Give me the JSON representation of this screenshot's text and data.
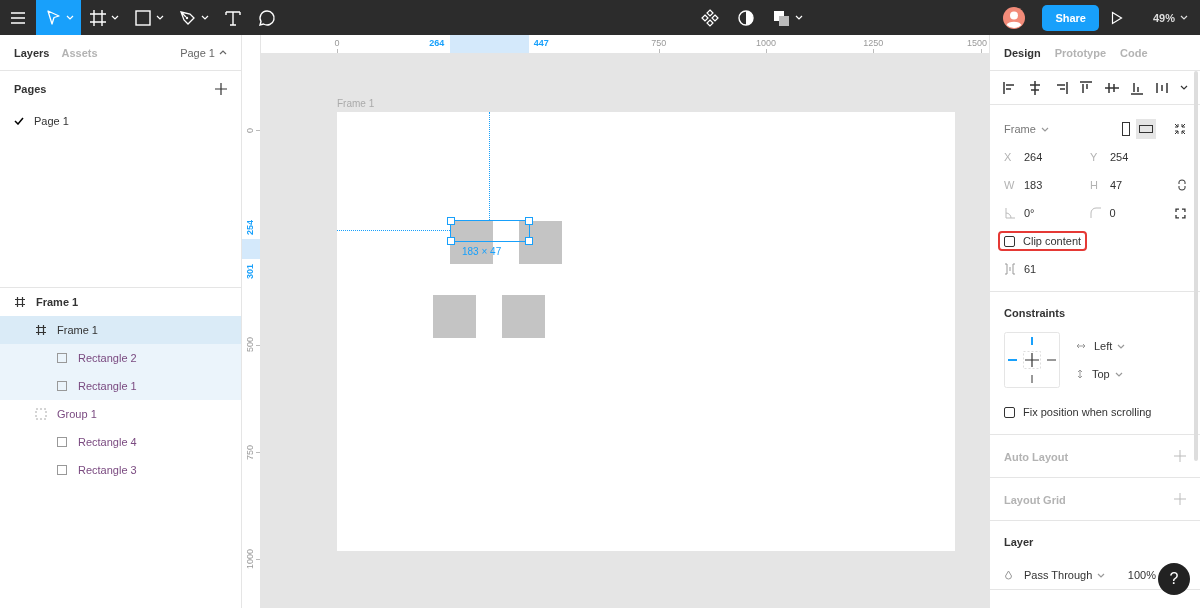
{
  "toolbar": {
    "tools": [
      {
        "kind": "menu",
        "selected": false,
        "menu": false
      },
      {
        "kind": "move",
        "selected": true,
        "menu": true
      },
      {
        "kind": "frame",
        "selected": false,
        "menu": true
      },
      {
        "kind": "rectangle",
        "selected": false,
        "menu": true
      },
      {
        "kind": "pen",
        "selected": false,
        "menu": true
      },
      {
        "kind": "text",
        "selected": false,
        "menu": false
      },
      {
        "kind": "comment",
        "selected": false,
        "menu": false
      }
    ],
    "center_tools": [
      {
        "kind": "component",
        "menu": false
      },
      {
        "kind": "mask",
        "menu": false
      },
      {
        "kind": "boolean",
        "menu": true
      }
    ],
    "share": "Share",
    "zoom": "49%"
  },
  "left_panel": {
    "tabs": [
      {
        "label": "Layers",
        "selected": true
      },
      {
        "label": "Assets",
        "selected": false
      }
    ],
    "page_menu": "Page 1",
    "pages_title": "Pages",
    "pages": [
      {
        "label": "Page 1",
        "selected": true
      }
    ],
    "layers": [
      {
        "name": "Frame 1",
        "kind": "frame",
        "selected": false,
        "children": [
          {
            "name": "Frame 1",
            "kind": "frame",
            "selected": true,
            "children": [
              {
                "name": "Rectangle 2",
                "kind": "rectangle",
                "selected": false
              },
              {
                "name": "Rectangle 1",
                "kind": "rectangle",
                "selected": false
              }
            ]
          },
          {
            "name": "Group 1",
            "kind": "group",
            "selected": false,
            "children": [
              {
                "name": "Rectangle 4",
                "kind": "rectangle",
                "selected": false
              },
              {
                "name": "Rectangle 3",
                "kind": "rectangle",
                "selected": false
              }
            ]
          }
        ]
      }
    ]
  },
  "canvas": {
    "ruler_top": [
      {
        "label": "0",
        "highlighted": false
      },
      {
        "label": "264",
        "highlighted": true
      },
      {
        "label": "447",
        "highlighted": true
      },
      {
        "label": "750",
        "highlighted": false
      },
      {
        "label": "1000",
        "highlighted": false
      },
      {
        "label": "1250",
        "highlighted": false
      },
      {
        "label": "1500",
        "highlighted": false
      }
    ],
    "ruler_left": [
      {
        "label": "0",
        "highlighted": false
      },
      {
        "label": "254",
        "highlighted": true
      },
      {
        "label": "301",
        "highlighted": true
      },
      {
        "label": "500",
        "highlighted": false
      },
      {
        "label": "750",
        "highlighted": false
      },
      {
        "label": "1000",
        "highlighted": false
      }
    ],
    "frame_label": "Frame 1",
    "size_label": "183 × 47"
  },
  "right_panel": {
    "tabs": [
      {
        "label": "Design",
        "selected": true
      },
      {
        "label": "Prototype",
        "selected": false
      },
      {
        "label": "Code",
        "selected": false
      }
    ],
    "frame_type": "Frame",
    "orientation": [
      {
        "kind": "portrait",
        "selected": false
      },
      {
        "kind": "landscape",
        "selected": true
      }
    ],
    "fields": [
      {
        "label": "X",
        "value": "264"
      },
      {
        "label": "Y",
        "value": "254"
      },
      {
        "label": "W",
        "value": "183"
      },
      {
        "label": "H",
        "value": "47"
      }
    ],
    "rotation": "0°",
    "radius": "0",
    "clip_content": {
      "label": "Clip content",
      "checked": false
    },
    "spacing": "61",
    "constraints": {
      "title": "Constraints",
      "horizontal": "Left",
      "vertical": "Top"
    },
    "fix_position": {
      "label": "Fix position when scrolling",
      "checked": false
    },
    "sections": [
      "Auto Layout",
      "Layout Grid"
    ],
    "layer": {
      "title": "Layer",
      "blend": "Pass Through",
      "opacity": "100%"
    },
    "help": "?"
  }
}
